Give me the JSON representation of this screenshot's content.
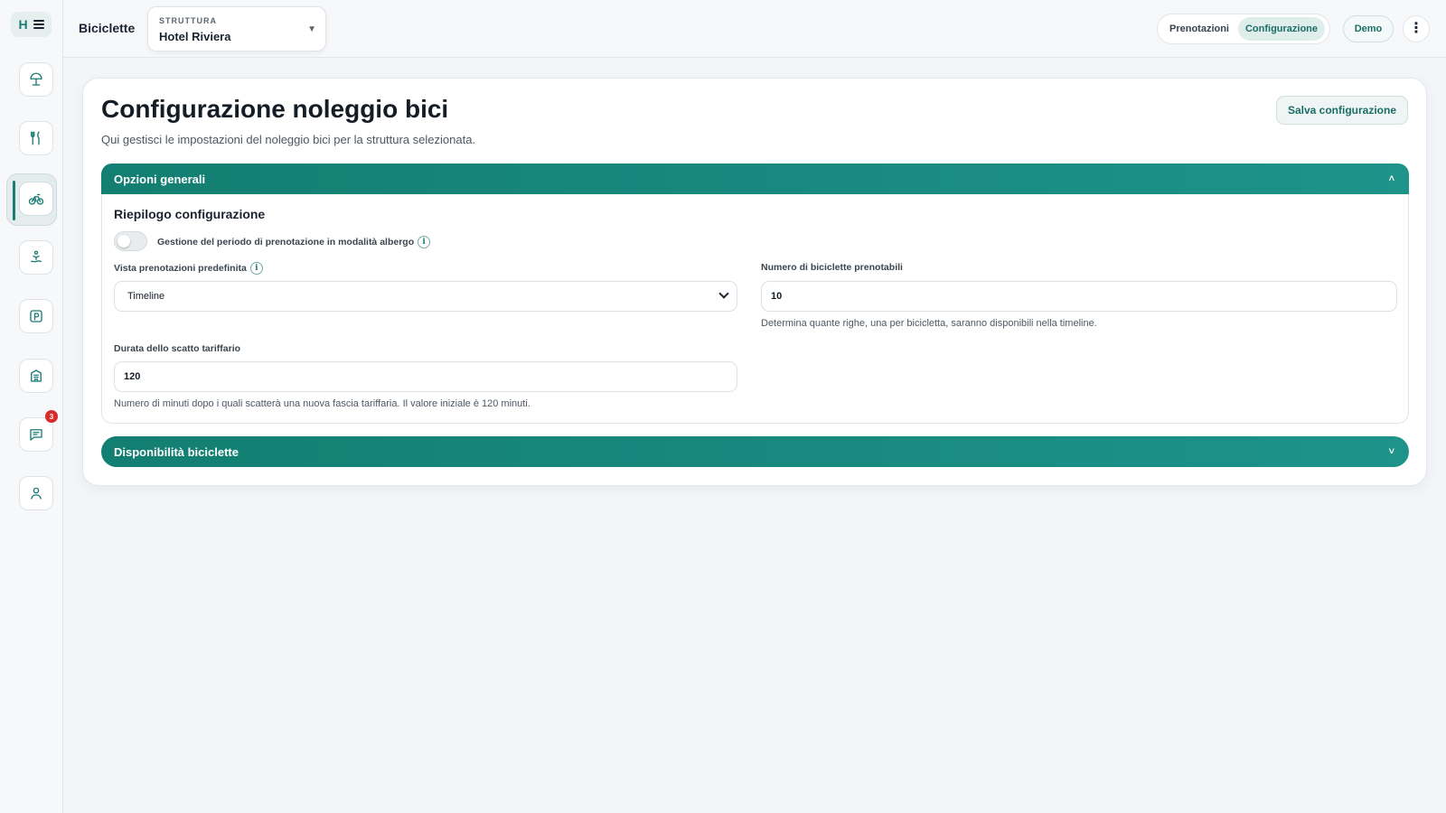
{
  "sidebar": {
    "logo_letter": "H",
    "badge_count": "3",
    "items": [
      {
        "icon": "beach-umbrella-icon"
      },
      {
        "icon": "fork-knife-icon"
      },
      {
        "icon": "bicycle-icon",
        "active": true
      },
      {
        "icon": "spa-icon"
      },
      {
        "icon": "parking-icon"
      },
      {
        "icon": "building-icon"
      },
      {
        "icon": "chat-icon"
      },
      {
        "icon": "user-icon"
      }
    ]
  },
  "topbar": {
    "section_title": "Biciclette",
    "structure_label": "STRUTTURA",
    "structure_value": "Hotel Riviera",
    "tabs": [
      "Prenotazioni",
      "Configurazione"
    ],
    "active_tab": "Configurazione",
    "demo_label": "Demo"
  },
  "main": {
    "title": "Configurazione noleggio bici",
    "subtitle": "Qui gestisci le impostazioni del noleggio bici per la struttura selezionata.",
    "save_label": "Salva configurazione",
    "accordion_general": "Opzioni generali",
    "summary_title": "Riepilogo configurazione",
    "toggle_label": "Gestione del periodo di prenotazione in modalità albergo",
    "view_label": "Vista prenotazioni predefinita",
    "view_value": "Timeline",
    "bikes_label": "Numero di biciclette prenotabili",
    "bikes_value": "10",
    "bikes_help": "Determina quante righe, una per bicicletta, saranno disponibili nella timeline.",
    "duration_label": "Durata dello scatto tariffario",
    "duration_value": "120",
    "duration_help": "Numero di minuti dopo i quali scatterà una nuova fascia tariffaria. Il valore iniziale è 120 minuti.",
    "accordion_availability": "Disponibilità biciclette"
  },
  "colors": {
    "accent": "#1a7c73",
    "accordion": "#137e72",
    "badge": "#d82b2b"
  }
}
